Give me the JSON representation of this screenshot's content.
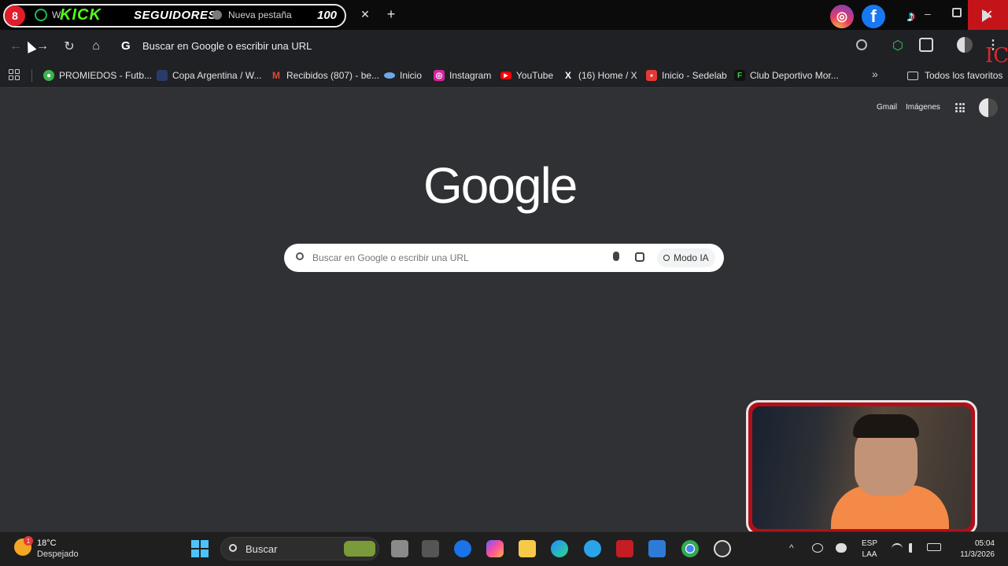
{
  "overlay": {
    "live_count": "8",
    "ghost_tab_text": "W",
    "kick_label": "KICK",
    "seguidores_label": "SEGUIDORES",
    "followers_count": "100",
    "ic_text": "IC"
  },
  "tabs": [
    {
      "title": "Nueva pestaña",
      "close_label": "✕"
    }
  ],
  "new_tab_label": "+",
  "window": {
    "minimize": "–",
    "close": "✕"
  },
  "toolbar": {
    "back": "←",
    "forward": "→",
    "reload": "↻",
    "home": "⌂",
    "omnibox_g": "G",
    "omnibox_text": "Buscar en Google o escribir una URL",
    "menu": "⋮"
  },
  "bookmarks": {
    "items": [
      {
        "label": "PROMIEDOS - Futb...",
        "icon": "promiedos-icon",
        "color": "#3bb54a",
        "glyph": "●"
      },
      {
        "label": "Copa Argentina / W...",
        "icon": "copa-argentina-icon",
        "color": "#202124",
        "glyph": ""
      },
      {
        "label": "Recibidos (807) - be...",
        "icon": "gmail-icon",
        "color": "#ea4335",
        "glyph": "M"
      },
      {
        "label": "Inicio",
        "icon": "inicio-icon",
        "color": "#6da9e4",
        "glyph": ""
      },
      {
        "label": "Instagram",
        "icon": "instagram-icon",
        "color": "#d6249f",
        "glyph": "◎"
      },
      {
        "label": "YouTube",
        "icon": "youtube-icon",
        "color": "#ff0000",
        "glyph": "▶"
      },
      {
        "label": "(16) Home / X",
        "icon": "x-icon",
        "color": "#202124",
        "glyph": "X"
      },
      {
        "label": "Inicio - Sedelab",
        "icon": "sedelab-icon",
        "color": "#e53935",
        "glyph": "●"
      },
      {
        "label": "Club Deportivo Mor...",
        "icon": "club-icon",
        "color": "#111111",
        "glyph": "F"
      }
    ],
    "more": "»",
    "all_label": "Todos los favoritos"
  },
  "google": {
    "gmail": "Gmail",
    "images": "Imágenes",
    "logo": "Google",
    "search_placeholder": "Buscar en Google o escribir una URL",
    "ai_mode": "Modo IA"
  },
  "taskbar": {
    "temperature": "18°C",
    "condition": "Despejado",
    "weather_badge": "1",
    "search_label": "Buscar",
    "lang_top": "ESP",
    "lang_bottom": "LAA",
    "time": "05:04",
    "date": "11/3/2026",
    "tray_caret": "^"
  },
  "colors": {
    "page_bg": "#303134",
    "chrome_bg": "#202124",
    "accent_red": "#c4141a",
    "kick_green": "#53fc18"
  }
}
